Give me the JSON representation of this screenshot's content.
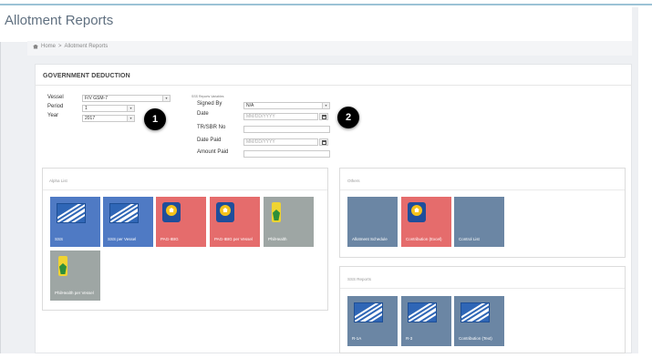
{
  "page": {
    "title": "Allotment Reports"
  },
  "breadcrumb": {
    "home": "Home",
    "separator": ">",
    "current": "Allotment Reports"
  },
  "section": {
    "title": "GOVERNMENT DEDUCTION"
  },
  "form_left": {
    "vessel": {
      "label": "Vessel",
      "value": "F/V GSM-7"
    },
    "period": {
      "label": "Period",
      "value": "1"
    },
    "year": {
      "label": "Year",
      "value": "2017"
    }
  },
  "form_right": {
    "group_label": "SSS Reports Variables",
    "signed_by": {
      "label": "Signed By",
      "value": "N/A"
    },
    "date": {
      "label": "Date",
      "placeholder": "MM/DD/YYYY"
    },
    "tr_sbr": {
      "label": "TR/SBR No",
      "value": ""
    },
    "date_paid": {
      "label": "Date Paid",
      "placeholder": "MM/DD/YYYY"
    },
    "amount_paid": {
      "label": "Amount Paid",
      "value": ""
    }
  },
  "callouts": {
    "one": "1",
    "two": "2"
  },
  "alpha_list": {
    "title": "Alpha List",
    "tiles": [
      {
        "label": "SSS",
        "icon": "sss-icon",
        "color": "#4f7ac4"
      },
      {
        "label": "SSS per Vessel",
        "icon": "sss-icon",
        "color": "#4f7ac4"
      },
      {
        "label": "PAG-IBIG",
        "icon": "pag-ibig-icon",
        "color": "#e56c6c"
      },
      {
        "label": "PAG-IBIG per Vessel",
        "icon": "pag-ibig-icon",
        "color": "#e56c6c"
      },
      {
        "label": "PhilHealth",
        "icon": "philhealth-icon",
        "color": "#9ea6a4"
      },
      {
        "label": "PhilHealth per Vessel",
        "icon": "philhealth-icon",
        "color": "#9ea6a4"
      }
    ]
  },
  "others": {
    "title": "Others",
    "tiles": [
      {
        "label": "Allotment Schedule",
        "color": "#6b86a4"
      },
      {
        "label": "Contribution (Excel)",
        "icon": "pag-ibig-icon",
        "color": "#e56c6c"
      },
      {
        "label": "Control List",
        "color": "#6b86a4"
      }
    ]
  },
  "sss_reports": {
    "title": "SSS Reports",
    "tiles": [
      {
        "label": "R-1A",
        "icon": "sss-icon",
        "color": "#6b86a4"
      },
      {
        "label": "R-3",
        "icon": "sss-icon",
        "color": "#6b86a4"
      },
      {
        "label": "Contribution (Text)",
        "icon": "sss-icon",
        "color": "#6b86a4"
      }
    ]
  }
}
